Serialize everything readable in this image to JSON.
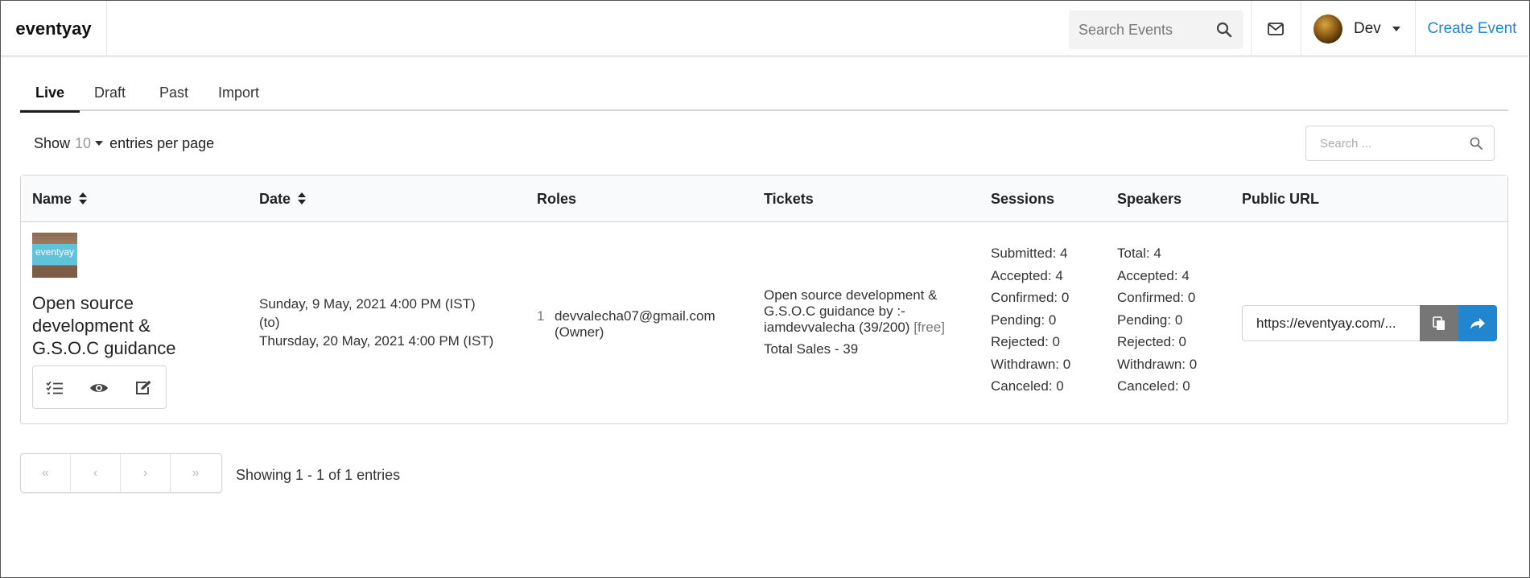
{
  "navbar": {
    "brand": "eventyay",
    "search_placeholder": "Search Events",
    "user_name": "Dev",
    "create_event": "Create Event"
  },
  "tabs": [
    {
      "label": "Live",
      "active": true
    },
    {
      "label": "Draft",
      "active": false
    },
    {
      "label": "Past",
      "active": false
    },
    {
      "label": "Import",
      "active": false
    }
  ],
  "entries": {
    "show_label": "Show",
    "per_page": "10",
    "suffix": "entries per page"
  },
  "table_search_placeholder": "Search ...",
  "columns": {
    "name": "Name",
    "date": "Date",
    "roles": "Roles",
    "tickets": "Tickets",
    "sessions": "Sessions",
    "speakers": "Speakers",
    "public_url": "Public URL"
  },
  "row": {
    "thumb_text": "eventyay",
    "name": "Open source development & G.S.O.C guidance",
    "date_start": "Sunday, 9 May, 2021 4:00 PM (IST)",
    "date_to": "(to)",
    "date_end": "Thursday, 20 May, 2021 4:00 PM (IST)",
    "role_index": "1",
    "role_email": "devvalecha07@gmail.com",
    "role_type": "(Owner)",
    "ticket_desc": "Open source development & G.S.O.C guidance by :- iamdevvalecha (39/200)",
    "ticket_free": "[free]",
    "total_sales": "Total Sales - 39",
    "sessions": [
      "Submitted: 4",
      "Accepted: 4",
      "Confirmed: 0",
      "Pending: 0",
      "Rejected: 0",
      "Withdrawn: 0",
      "Canceled: 0"
    ],
    "speakers": [
      "Total: 4",
      "Accepted: 4",
      "Confirmed: 0",
      "Pending: 0",
      "Rejected: 0",
      "Withdrawn: 0",
      "Canceled: 0"
    ],
    "public_url": "https://eventyay.com/..."
  },
  "pagination": {
    "first": "«",
    "prev": "‹",
    "next": "›",
    "last": "»",
    "showing": "Showing 1 - 1 of 1 entries"
  },
  "colors": {
    "accent": "#2185d0",
    "copy_button": "#767676"
  }
}
